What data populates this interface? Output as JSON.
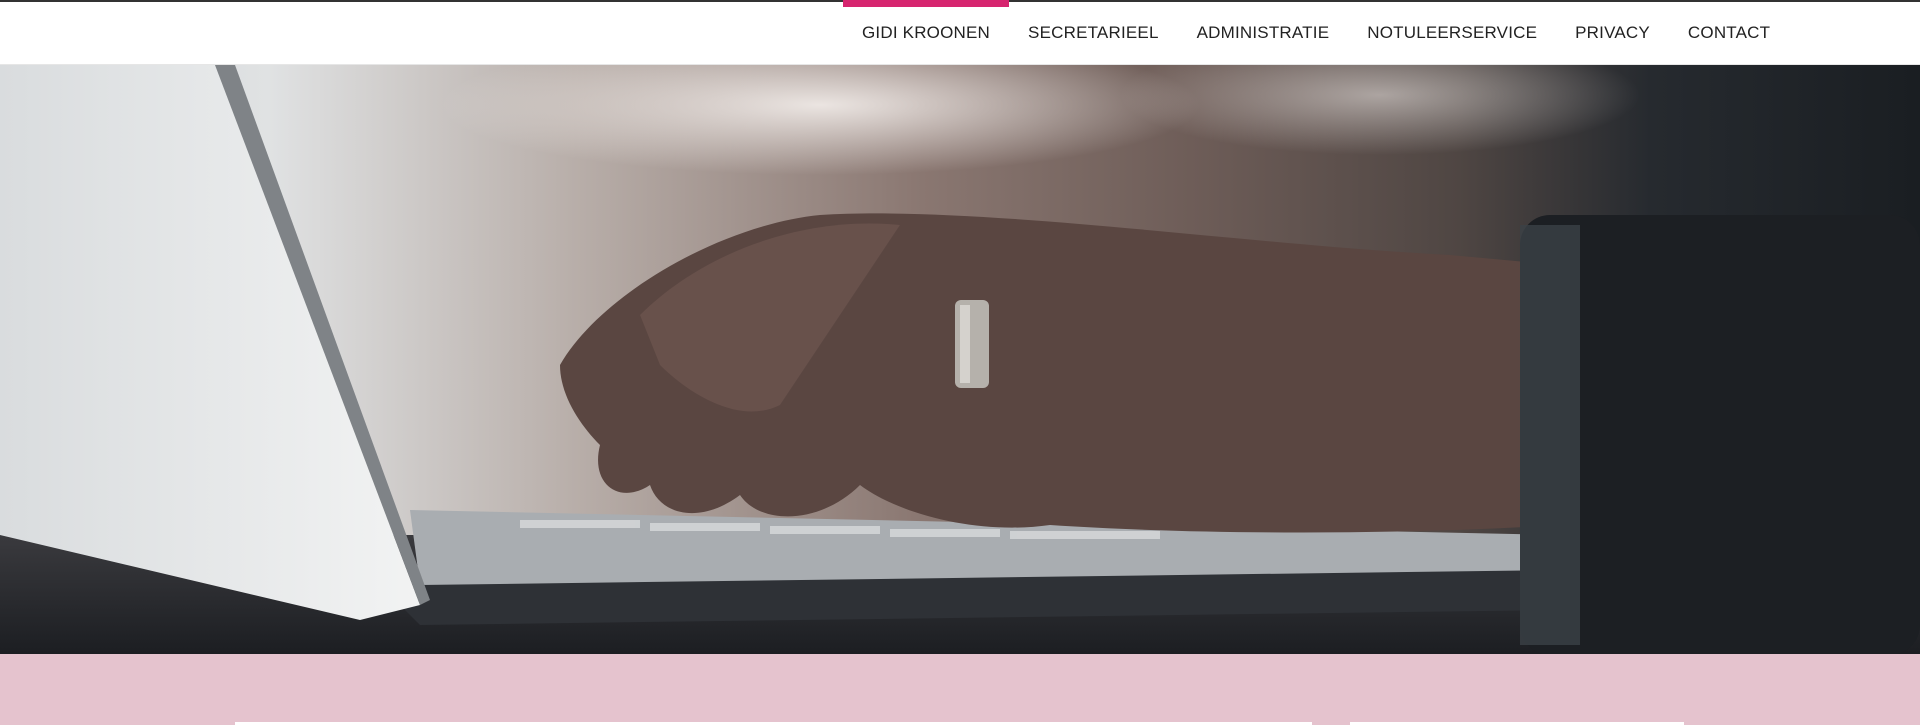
{
  "nav": {
    "active_color": "#d6256f",
    "items": [
      {
        "label": "GIDI KROONEN",
        "active": true
      },
      {
        "label": "SECRETARIEEL",
        "active": false
      },
      {
        "label": "ADMINISTRATIE",
        "active": false
      },
      {
        "label": "NOTULEERSERVICE",
        "active": false
      },
      {
        "label": "PRIVACY",
        "active": false
      },
      {
        "label": "CONTACT",
        "active": false
      }
    ]
  },
  "colors": {
    "content_band": "#e5c3ce"
  }
}
